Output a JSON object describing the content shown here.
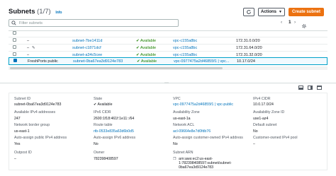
{
  "header": {
    "title": "Subnets",
    "count": "(1/7)",
    "info": "Info",
    "actions_label": "Actions",
    "create_label": "Create subnet"
  },
  "search": {
    "placeholder": "Filter subnets"
  },
  "pager": {
    "page": "1"
  },
  "rows": [
    {
      "name": "",
      "subnet": "",
      "state": "",
      "vpc": "",
      "cidr": ""
    },
    {
      "name": "–",
      "subnet": "subnet-7be1411d",
      "state": "Available",
      "vpc": "vpc-c155a8bc",
      "cidr": "172.31.0.0/20"
    },
    {
      "name": "–",
      "subnet": "subnet-c1871dcf",
      "state": "Available",
      "vpc": "vpc-c155a8bc",
      "cidr": "172.31.64.0/20"
    },
    {
      "name": "–",
      "subnet": "subnet-a34c5cee",
      "state": "Available",
      "vpc": "vpc-c155a8bc",
      "cidr": "172.31.32.0/20"
    },
    {
      "name": "FreshPorts public",
      "subnet": "subnet-0ba67ea3d9124e783",
      "state": "Available",
      "vpc": "vpc-0977475a2d46855f1 | vpc...",
      "cidr": "10.17.0/24"
    }
  ],
  "details": {
    "subnet_id_label": "Subnet ID",
    "subnet_id": "subnet-0ba67ea3d9124e783",
    "state_label": "State",
    "state": "Available",
    "vpc_label": "VPC",
    "vpc": "vpc-0977475a2d46855f1 | vpc-public",
    "ipv4_cidr_label": "IPv4 CIDR",
    "ipv4_cidr": "10.0.17.0/24",
    "avail_ipv4_label": "Available IPv4 addresses",
    "avail_ipv4": "247",
    "ipv6_cidr_label": "IPv6 CIDR",
    "ipv6_cidr": "2600:1f18:461f:1e11::/64",
    "az_label": "Availability Zone",
    "az": "us-east-1a",
    "az_id_label": "Availability Zone ID",
    "az_id": "use1-az4",
    "nbg_label": "Network border group",
    "nbg": "us-east-1",
    "route_table_label": "Route table",
    "route_table": "rtb-0533e835a63d6b0d5",
    "nacl_label": "Network ACL",
    "nacl": "acl-09664e8e7d0fdb76",
    "default_subnet_label": "Default subnet",
    "default_subnet": "No",
    "auto_ipv4_label": "Auto-assign public IPv4 address",
    "auto_ipv4": "Yes",
    "auto_ipv6_label": "Auto-assign IPv6 address",
    "auto_ipv6": "No",
    "auto_coip_label": "Auto-assign customer-owned IPv4 address",
    "auto_coip": "No",
    "coip_pool_label": "Customer-owned IPv4 pool",
    "coip_pool": "–",
    "outpost_label": "Outpost ID",
    "outpost": "–",
    "owner_label": "Owner",
    "owner": "782398408597",
    "arn_label": "Subnet ARN",
    "arn_line1": "arn:aws:ec2:us-east-",
    "arn_line2": "1:782398408597:subnet/subnet-",
    "arn_line3": "0ba67ea3d9124e783"
  }
}
